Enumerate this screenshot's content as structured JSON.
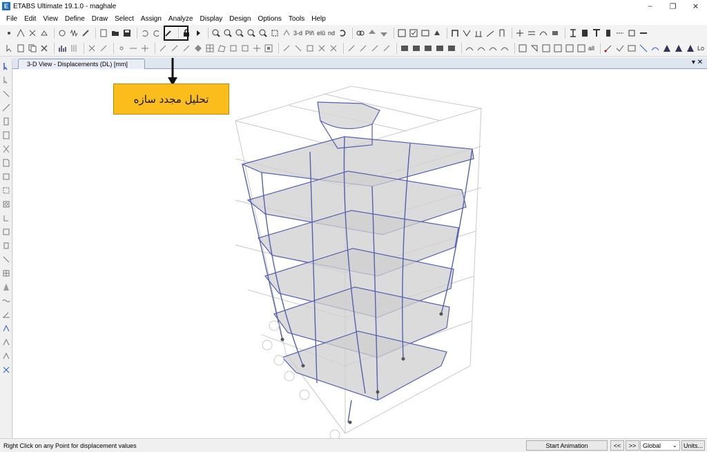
{
  "window": {
    "title": "ETABS Ultimate 19.1.0 - maghale",
    "app_icon_letter": "E",
    "minimize": "–",
    "maximize": "❐",
    "close": "✕"
  },
  "menu": [
    "File",
    "Edit",
    "View",
    "Define",
    "Draw",
    "Select",
    "Assign",
    "Analyze",
    "Display",
    "Design",
    "Options",
    "Tools",
    "Help"
  ],
  "toolbar": {
    "label_3d": "3-d",
    "label_plan": "Plñ",
    "label_elev": "elŭ",
    "label_nd": "nd",
    "label_all": "all",
    "label_lo": "Lo"
  },
  "tab": {
    "title": "3-D View  - Displacements (DL)  [mm]",
    "controls": "▾ ✕"
  },
  "callout": {
    "text": "تحلیل مجدد سازه"
  },
  "status": {
    "message": "Right Click on any Point for displacement values",
    "animation_button": "Start Animation",
    "prev": "<<",
    "next": ">>",
    "coord_system": "Global",
    "units_button": "Units..."
  },
  "colors": {
    "frame": "#5560b0",
    "callout_bg": "#fbbd1b",
    "slab": "#cfcfcf"
  }
}
